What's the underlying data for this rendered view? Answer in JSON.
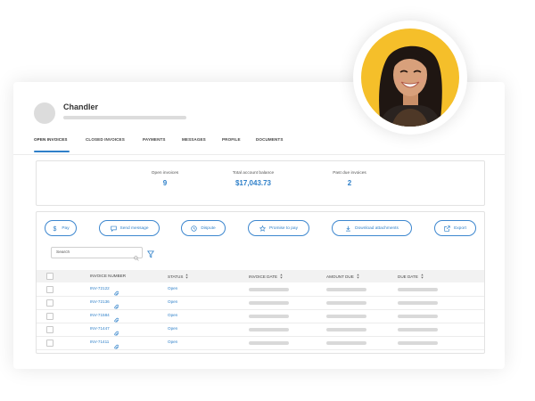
{
  "profile": {
    "name": "Chandler"
  },
  "tabs": [
    "OPEN INVOICES",
    "CLOSED INVOICES",
    "PAYMENTS",
    "MESSAGES",
    "PROFILE",
    "DOCUMENTS"
  ],
  "active_tab": "OPEN INVOICES",
  "summary": {
    "open_invoices_label": "Open invoices",
    "open_invoices_value": "9",
    "balance_label": "Total account balance",
    "balance_value": "$17,043.73",
    "past_due_label": "Past due invoices",
    "past_due_value": "2"
  },
  "actions": {
    "pay": "Pay",
    "send_message": "Send message",
    "dispute": "Dispute",
    "promise": "Promise to pay",
    "download": "Download attachments",
    "export": "Export"
  },
  "search": {
    "placeholder": "Search"
  },
  "table": {
    "headers": {
      "invoice_number": "INVOICE NUMBER",
      "status": "STATUS",
      "invoice_date": "INVOICE DATE",
      "amount_due": "AMOUNT DUE",
      "due_date": "DUE DATE"
    },
    "rows": [
      {
        "invoice": "INV-72122",
        "status": "Open"
      },
      {
        "invoice": "INV-72136",
        "status": "Open"
      },
      {
        "invoice": "INV-71584",
        "status": "Open"
      },
      {
        "invoice": "INV-71447",
        "status": "Open"
      },
      {
        "invoice": "INV-71411",
        "status": "Open"
      }
    ]
  },
  "colors": {
    "accent": "#2f80c9",
    "skeleton": "#d9d9d9",
    "photo_background": "#f5bf2a"
  },
  "icons": [
    "dollar-icon",
    "message-icon",
    "clock-icon",
    "star-icon",
    "download-icon",
    "export-icon",
    "search-icon",
    "filter-icon",
    "paperclip-icon",
    "sort-icon"
  ]
}
